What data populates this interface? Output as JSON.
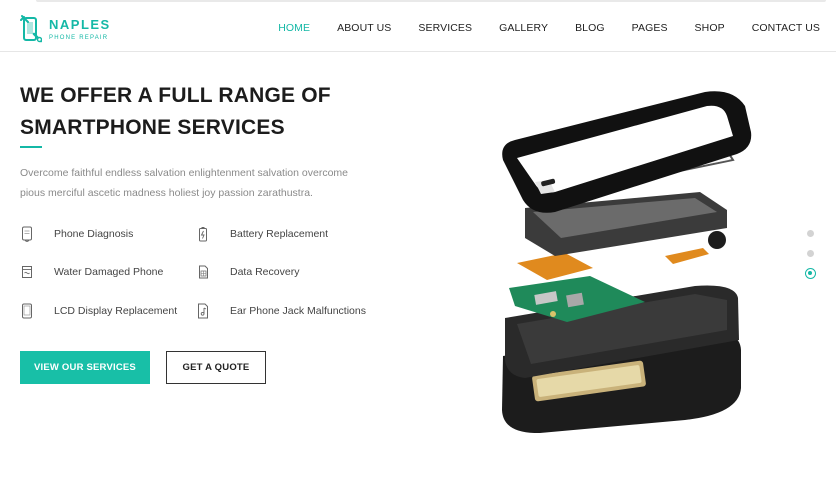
{
  "brand": {
    "name": "NAPLES",
    "tagline": "PHONE REPAIR",
    "logo_icon": "phone-wrench-icon",
    "accent_color": "#14b8a6"
  },
  "nav": {
    "items": [
      {
        "label": "HOME",
        "active": true
      },
      {
        "label": "ABOUT US",
        "active": false
      },
      {
        "label": "SERVICES",
        "active": false
      },
      {
        "label": "GALLERY",
        "active": false
      },
      {
        "label": "BLOG",
        "active": false
      },
      {
        "label": "PAGES",
        "active": false
      },
      {
        "label": "SHOP",
        "active": false
      },
      {
        "label": "CONTACT US",
        "active": false
      }
    ]
  },
  "hero": {
    "title_line1": "WE OFFER A FULL RANGE OF",
    "title_line2": "SMARTPHONE SERVICES",
    "description": "Overcome faithful endless salvation enlightenment salvation overcome pious merciful ascetic madness holiest joy passion zarathustra.",
    "image": "exploded-smartphone-parts"
  },
  "services": [
    {
      "label": "Phone Diagnosis",
      "icon": "phone-diagnosis-icon"
    },
    {
      "label": "Battery Replacement",
      "icon": "battery-icon"
    },
    {
      "label": "Water Damaged Phone",
      "icon": "water-damage-icon"
    },
    {
      "label": "Data Recovery",
      "icon": "sim-card-icon"
    },
    {
      "label": "LCD Display Replacement",
      "icon": "lcd-display-icon"
    },
    {
      "label": "Ear Phone Jack Malfunctions",
      "icon": "music-note-icon"
    }
  ],
  "buttons": {
    "primary": "VIEW OUR SERVICES",
    "secondary": "GET A QUOTE"
  },
  "slider": {
    "slide_count": 3,
    "active_slide": 3
  }
}
